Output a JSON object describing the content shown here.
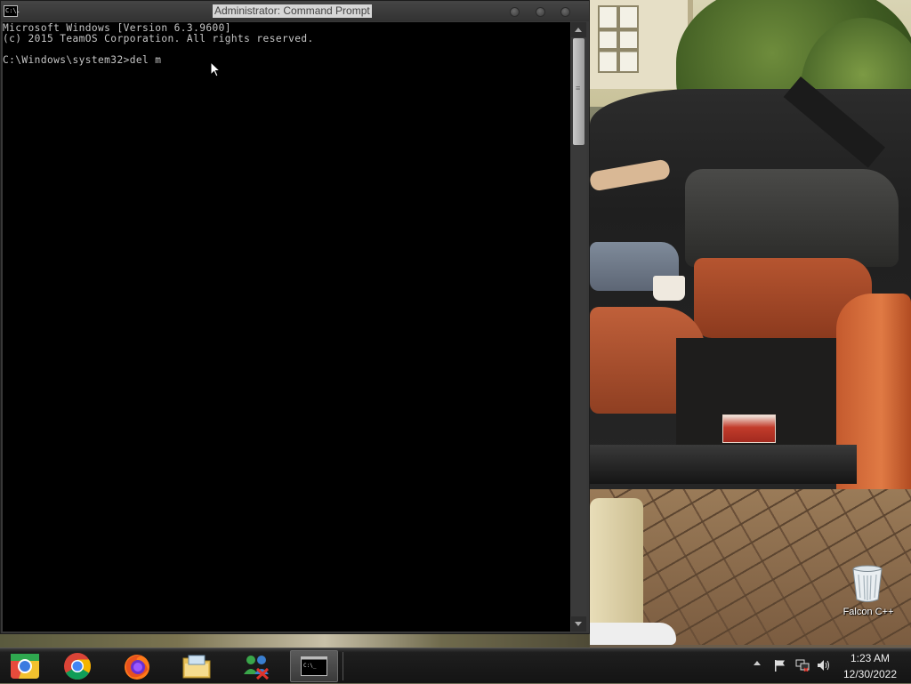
{
  "window": {
    "title": "Administrator: Command Prompt",
    "icon_text": "C:\\."
  },
  "console": {
    "lines": [
      "Microsoft Windows [Version 6.3.9600]",
      "(c) 2015 TeamOS Corporation. All rights reserved.",
      "C:\\Windows\\system32>del m"
    ]
  },
  "desktop": {
    "icons": [
      {
        "label": "Falcon C++",
        "icon": "recycle-bin-icon"
      }
    ]
  },
  "taskbar": {
    "apps": [
      {
        "name": "chromium",
        "icon": "chromium-icon"
      },
      {
        "name": "chrome",
        "icon": "chrome-icon"
      },
      {
        "name": "firefox",
        "icon": "firefox-icon"
      },
      {
        "name": "file-explorer",
        "icon": "folder-icon"
      },
      {
        "name": "network-app",
        "icon": "network-people-icon"
      },
      {
        "name": "command-prompt",
        "icon": "cmd-icon",
        "label": "C:\\_",
        "active": true
      }
    ],
    "tray": {
      "icons": [
        "chevron-up-icon",
        "flag-icon",
        "network-icon",
        "volume-icon"
      ],
      "time": "1:23 AM",
      "date": "12/30/2022"
    }
  },
  "colors": {
    "console_bg": "#000000",
    "console_text": "#c6c6c6",
    "window_frame": "#383838",
    "taskbar": "#141414"
  }
}
